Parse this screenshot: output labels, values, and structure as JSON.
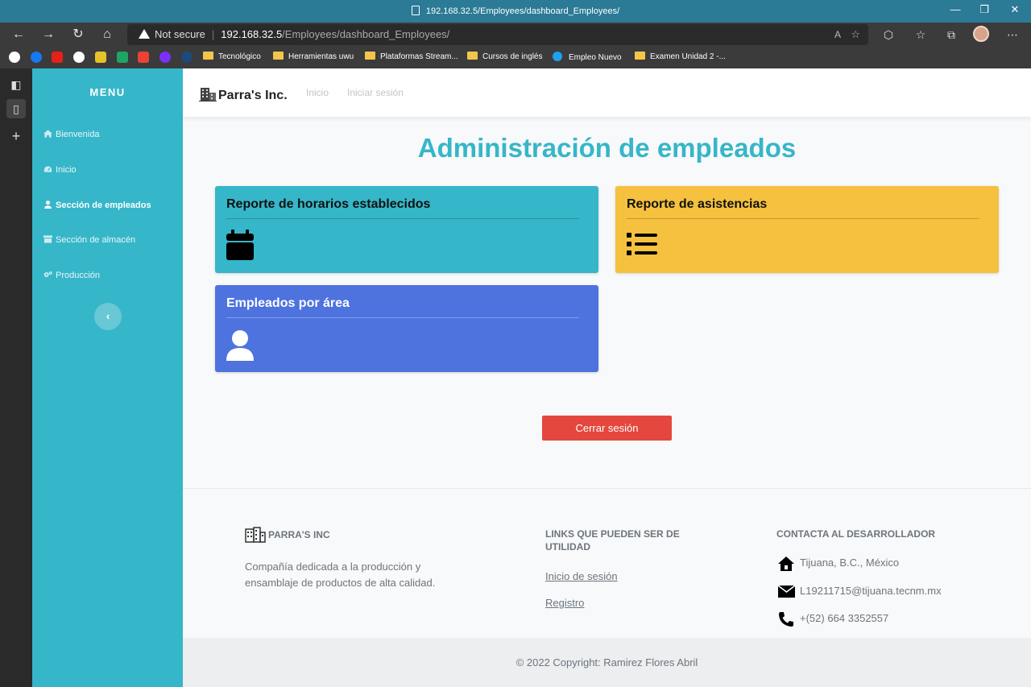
{
  "browser": {
    "window_title": "192.168.32.5/Employees/dashboard_Employees/",
    "security_label": "Not secure",
    "url_host": "192.168.32.5",
    "url_path": "/Employees/dashboard_Employees/",
    "bookmarks": [
      "Tecnológico",
      "Herramientas uwu",
      "Plataformas Stream...",
      "Cursos de inglés",
      "Empleo Nuevo",
      "Examen Unidad 2 -..."
    ]
  },
  "sidebar": {
    "title": "MENU",
    "items": [
      {
        "label": "Bienvenida",
        "icon": "home-icon"
      },
      {
        "label": "Inicio",
        "icon": "gauge-icon"
      },
      {
        "label": "Sección de empleados",
        "icon": "user-icon",
        "active": true
      },
      {
        "label": "Sección de almacén",
        "icon": "warehouse-icon"
      },
      {
        "label": "Producción",
        "icon": "gears-icon"
      }
    ]
  },
  "navbar": {
    "brand": "Parra's Inc.",
    "links": [
      "Inicio",
      "Iniciar sesión"
    ]
  },
  "main": {
    "title": "Administración de empleados",
    "cards": [
      {
        "title": "Reporte de horarios establecidos",
        "icon": "calendar-icon",
        "color": "#36b6c9"
      },
      {
        "title": "Reporte de asistencias",
        "icon": "list-icon",
        "color": "#f5c13e"
      },
      {
        "title": "Empleados por área",
        "icon": "user-icon",
        "color": "#4e73df"
      }
    ],
    "logout_label": "Cerrar sesión"
  },
  "footer": {
    "company_title": "PARRA'S INC",
    "company_desc": "Compañía dedicada a la producción y ensamblaje de productos de alta calidad.",
    "links_title": "LINKS QUE PUEDEN SER DE UTILIDAD",
    "links": [
      "Inicio de sesión",
      "Registro"
    ],
    "contact_title": "CONTACTA AL DESARROLLADOR",
    "contact": {
      "location": "Tijuana, B.C., México",
      "email": "L19211715@tijuana.tecnm.mx",
      "phone": "+(52) 664 3352557"
    },
    "copyright": "© 2022 Copyright: Ramirez Flores Abril"
  },
  "colors": {
    "accent": "#36b6c9",
    "warning": "#f5c13e",
    "primary": "#4e73df",
    "danger": "#e4473d"
  }
}
